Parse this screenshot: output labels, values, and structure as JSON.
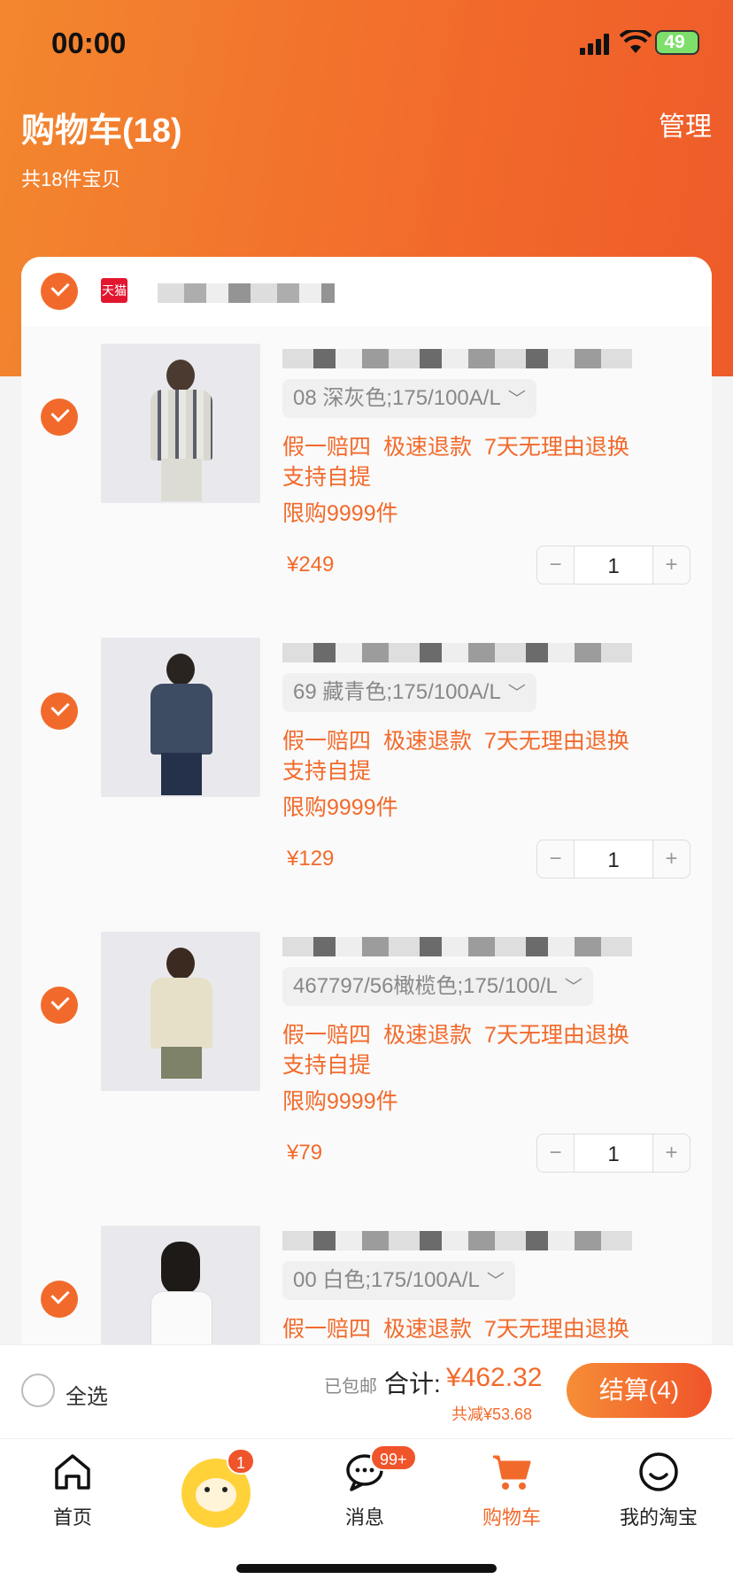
{
  "status_bar": {
    "time": "00:00",
    "battery": "49"
  },
  "header": {
    "title": "购物车(18)",
    "manage_label": "管理",
    "subtitle": "共18件宝贝"
  },
  "shop": {
    "badge": "天猫"
  },
  "items": [
    {
      "sku": "08 深灰色;175/100A/L",
      "tags": [
        "假一赔四",
        "极速退款",
        "7天无理由退换",
        "支持自提"
      ],
      "limit": "限购9999件",
      "price": "¥249",
      "qty": "1"
    },
    {
      "sku": "69 藏青色;175/100A/L",
      "tags": [
        "假一赔四",
        "极速退款",
        "7天无理由退换",
        "支持自提"
      ],
      "limit": "限购9999件",
      "price": "¥129",
      "qty": "1"
    },
    {
      "sku": "467797/56橄榄色;175/100/L",
      "tags": [
        "假一赔四",
        "极速退款",
        "7天无理由退换",
        "支持自提"
      ],
      "limit": "限购9999件",
      "price": "¥79",
      "qty": "1"
    },
    {
      "sku": "00 白色;175/100A/L",
      "tags": [
        "假一赔四",
        "极速退款",
        "7天无理由退换"
      ],
      "limit": "",
      "price": "",
      "qty": ""
    }
  ],
  "checkout": {
    "select_all": "全选",
    "free_shipping": "已包邮",
    "total_label": "合计:",
    "total_amount": "¥462.32",
    "discount": "共减¥53.68",
    "checkout_button": "结算(4)"
  },
  "tabs": [
    {
      "label": "首页"
    },
    {
      "label": "",
      "badge": "1"
    },
    {
      "label": "消息",
      "badge": "99+"
    },
    {
      "label": "购物车"
    },
    {
      "label": "我的淘宝"
    }
  ],
  "colors": {
    "accent": "#f26a2b",
    "tmall": "#e3162f"
  }
}
